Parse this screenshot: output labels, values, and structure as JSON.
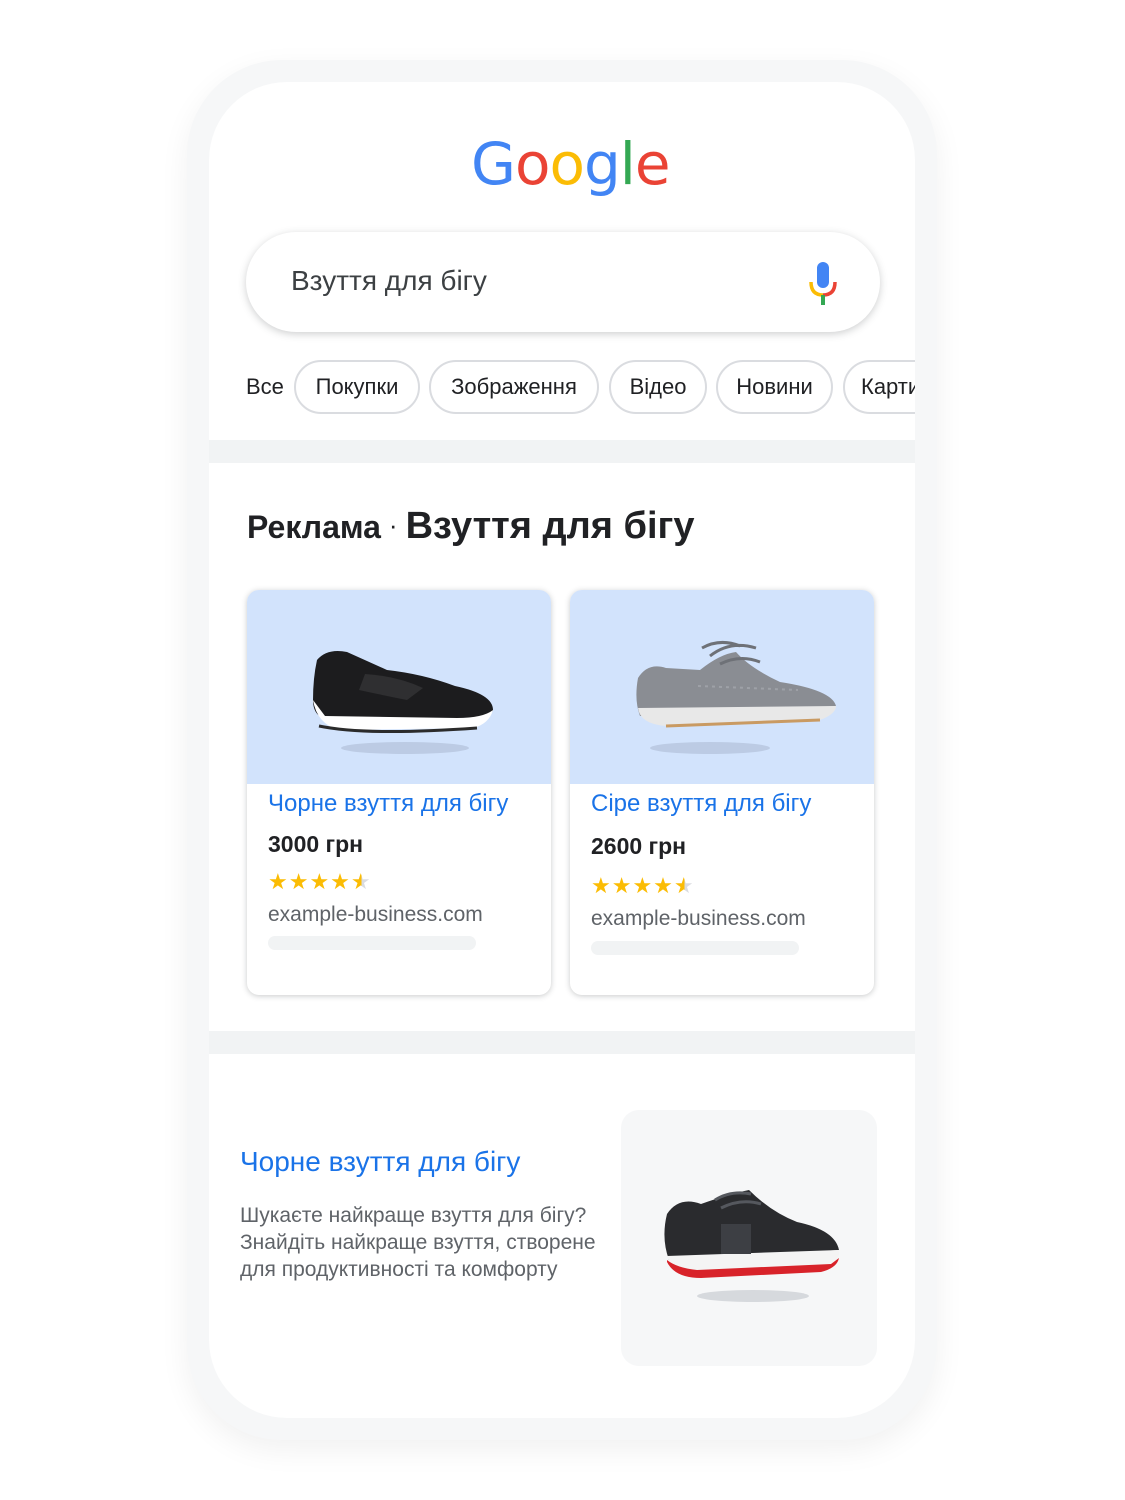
{
  "search": {
    "logo": [
      "G",
      "o",
      "o",
      "g",
      "l",
      "e"
    ],
    "logo_colors": [
      "#4285F4",
      "#EA4335",
      "#FBBC05",
      "#4285F4",
      "#34A853",
      "#EA4335"
    ],
    "query": "Взуття для бігу",
    "mic_icon": "mic-icon"
  },
  "tabs": {
    "all": "Все",
    "items": [
      "Покупки",
      "Зображення",
      "Відео",
      "Новини",
      "Карти"
    ]
  },
  "ads": {
    "label": "Реклама",
    "separator": "·",
    "heading": "Взуття для бігу",
    "cards": [
      {
        "title": "Чорне взуття для бігу",
        "price": "3000 грн",
        "rating": 4.5,
        "stars": "★★★★",
        "half": "★",
        "domain": "example-business.com"
      },
      {
        "title": "Сіре взуття для бігу",
        "price": "2600 грн",
        "rating": 4.5,
        "stars": "★★★★",
        "half": "★",
        "domain": "example-business.com"
      }
    ]
  },
  "result": {
    "title": "Чорне взуття для бігу",
    "description": "Шукаєте найкраще взуття для бігу? Знайдіть найкраще взуття, створене для продуктивності та комфорту"
  },
  "colors": {
    "link": "#1a73e8",
    "star": "#fbbc04",
    "card_image_bg": "#d2e3fc"
  }
}
